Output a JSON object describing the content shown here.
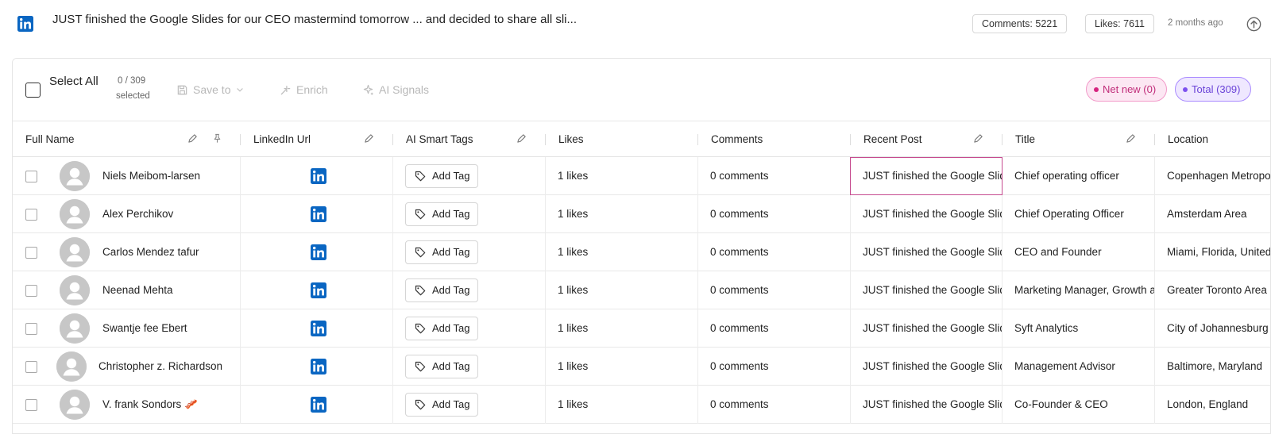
{
  "post": {
    "text": "JUST finished the Google Slides for our CEO mastermind tomorrow ... and decided to share all sli...",
    "comments_label": "Comments: 5221",
    "likes_label": "Likes: 7611",
    "time_ago": "2 months ago"
  },
  "toolbar": {
    "select_all_label": "Select All",
    "count_top": "0 / 309",
    "count_bottom": "selected",
    "save_label": "Save to",
    "enrich_label": "Enrich",
    "signals_label": "AI Signals",
    "net_new_label": "Net new (0)",
    "total_label": "Total (309)"
  },
  "columns": [
    "Full Name",
    "LinkedIn Url",
    "AI Smart Tags",
    "Likes",
    "Comments",
    "Recent Post",
    "Title",
    "Location"
  ],
  "add_tag_label": "Add Tag",
  "rows": [
    {
      "name": "Niels Meibom-larsen",
      "likes": "1 likes",
      "comments": "0 comments",
      "post": "JUST finished the Google Slides",
      "title": "Chief operating officer",
      "location": "Copenhagen Metropolitan Area"
    },
    {
      "name": "Alex Perchikov",
      "likes": "1 likes",
      "comments": "0 comments",
      "post": "JUST finished the Google Slides",
      "title": "Chief Operating Officer",
      "location": "Amsterdam Area"
    },
    {
      "name": "Carlos Mendez tafur",
      "likes": "1 likes",
      "comments": "0 comments",
      "post": "JUST finished the Google Slides",
      "title": "CEO and Founder",
      "location": "Miami, Florida, United States"
    },
    {
      "name": "Neenad Mehta",
      "likes": "1 likes",
      "comments": "0 comments",
      "post": "JUST finished the Google Slides",
      "title": "Marketing Manager, Growth and",
      "location": "Greater Toronto Area"
    },
    {
      "name": "Swantje fee Ebert",
      "likes": "1 likes",
      "comments": "0 comments",
      "post": "JUST finished the Google Slides",
      "title": "Syft Analytics",
      "location": "City of Johannesburg"
    },
    {
      "name": "Christopher z. Richardson",
      "likes": "1 likes",
      "comments": "0 comments",
      "post": "JUST finished the Google Slides",
      "title": "Management Advisor",
      "location": "Baltimore, Maryland"
    },
    {
      "name": "V. frank Sondors 🥓",
      "likes": "1 likes",
      "comments": "0 comments",
      "post": "JUST finished the Google Slides",
      "title": "Co-Founder & CEO",
      "location": "London, England"
    }
  ],
  "colors": {
    "accent": "#6a43d8",
    "pink": "#d6247f",
    "linkedin": "#0a66c2"
  }
}
